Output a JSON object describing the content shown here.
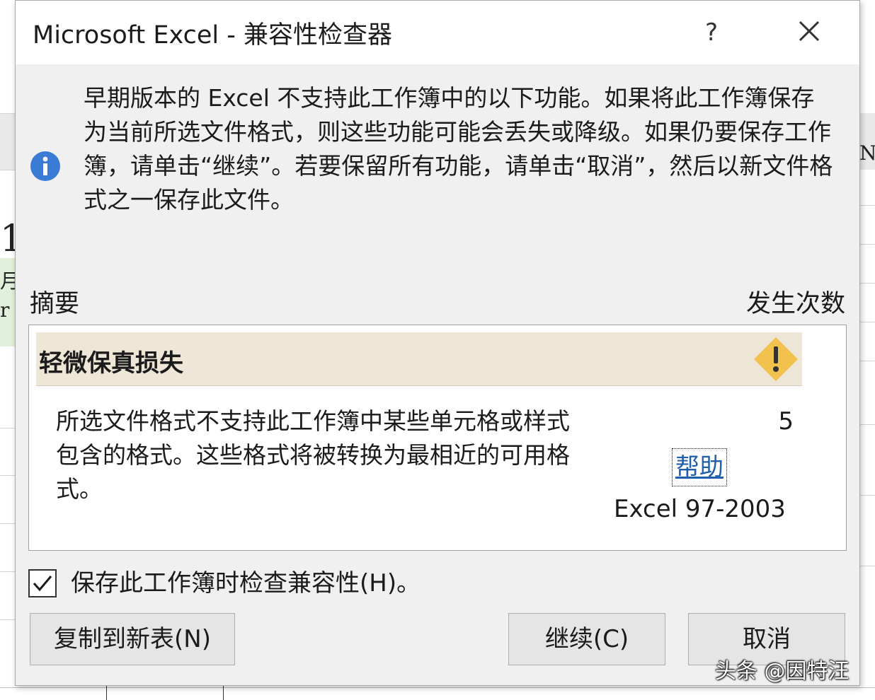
{
  "background": {
    "fragment_a": "1",
    "fragment_b": "月",
    "fragment_c": "r",
    "fragment_d": "N"
  },
  "dialog": {
    "title": "Microsoft Excel - 兼容性检查器",
    "help_glyph": "?",
    "close_icon": "close-x",
    "info_icon": "info-circle",
    "message": "早期版本的 Excel 不支持此工作簿中的以下功能。如果将此工作簿保存为当前所选文件格式，则这些功能可能会丢失或降级。如果仍要保存工作簿，请单击“继续”。若要保留所有功能，请单击“取消”，然后以新文件格式之一保存此文件。",
    "summary_label": "摘要",
    "occurrences_label": "发生次数",
    "category": {
      "title": "轻微保真损失",
      "icon": "warning-diamond",
      "color": "#eee6d7"
    },
    "issue": {
      "description": "所选文件格式不支持此工作簿中某些单元格或样式包含的格式。这些格式将被转换为最相近的可用格式。",
      "count": "5",
      "help_link": "帮助",
      "version": "Excel 97-2003"
    },
    "check_compat": {
      "label": "保存此工作簿时检查兼容性(H)。",
      "checked": true
    },
    "buttons": {
      "copy": "复制到新表(N)",
      "continue": "继续(C)",
      "cancel": "取消"
    }
  },
  "watermark": "头条 @因特汪",
  "colors": {
    "info_blue": "#3a7bd5",
    "warning_yellow": "#f2c14e",
    "link_blue": "#1f5fad"
  }
}
